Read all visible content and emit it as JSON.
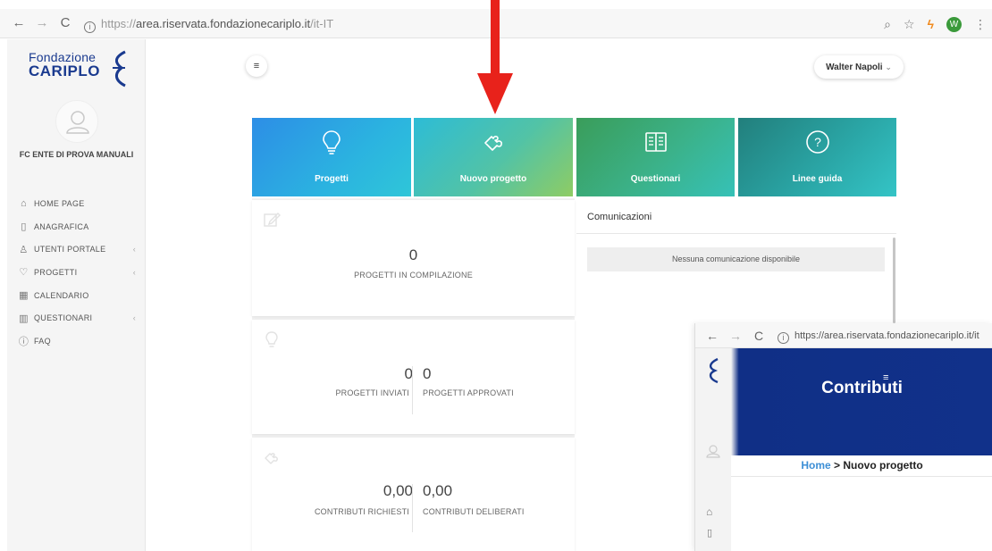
{
  "browser": {
    "url_prefix": "https://",
    "url_host": "area.riservata.fondazionecariplo.it",
    "url_path": "/it-IT",
    "profile_initial": "W"
  },
  "logo": {
    "line1": "Fondazione",
    "line2": "CARIPLO"
  },
  "sidebar": {
    "org_name": "FC ENTE DI PROVA MANUALI",
    "items": [
      {
        "label": "HOME PAGE",
        "icon": "home-icon",
        "has_caret": false
      },
      {
        "label": "ANAGRAFICA",
        "icon": "card-icon",
        "has_caret": false
      },
      {
        "label": "UTENTI PORTALE",
        "icon": "users-icon",
        "has_caret": true
      },
      {
        "label": "PROGETTI",
        "icon": "lightbulb-icon",
        "has_caret": true
      },
      {
        "label": "CALENDARIO",
        "icon": "calendar-icon",
        "has_caret": false
      },
      {
        "label": "QUESTIONARI",
        "icon": "book-icon",
        "has_caret": true
      },
      {
        "label": "FAQ",
        "icon": "info-icon",
        "has_caret": false
      }
    ]
  },
  "header": {
    "menu_symbol": "≡",
    "user_name": "Walter Napoli",
    "user_caret": "⌄"
  },
  "tiles": [
    {
      "label": "Progetti",
      "icon": "lightbulb-icon"
    },
    {
      "label": "Nuovo progetto",
      "icon": "puzzle-icon"
    },
    {
      "label": "Questionari",
      "icon": "book-icon"
    },
    {
      "label": "Linee guida",
      "icon": "question-icon"
    }
  ],
  "stats": {
    "in_compilazione": {
      "value": "0",
      "label": "PROGETTI IN COMPILAZIONE"
    },
    "inviati": {
      "value": "0",
      "label": "PROGETTI INVIATI"
    },
    "approvati": {
      "value": "0",
      "label": "PROGETTI APPROVATI"
    },
    "richiesti": {
      "value": "0,00",
      "label": "CONTRIBUTI RICHIESTI"
    },
    "deliberati": {
      "value": "0,00",
      "label": "CONTRIBUTI DELIBERATI"
    }
  },
  "comunicazioni": {
    "title": "Comunicazioni",
    "empty_message": "Nessuna comunicazione disponibile"
  },
  "inset": {
    "url": "https://area.riservata.fondazionecariplo.it/it",
    "title": "Contributi",
    "crumb_home": "Home",
    "crumb_rest": " > Nuovo progetto"
  },
  "colors": {
    "arrow": "#e8221b",
    "brand": "#1a3a8f",
    "inset_hero": "#11318a"
  }
}
